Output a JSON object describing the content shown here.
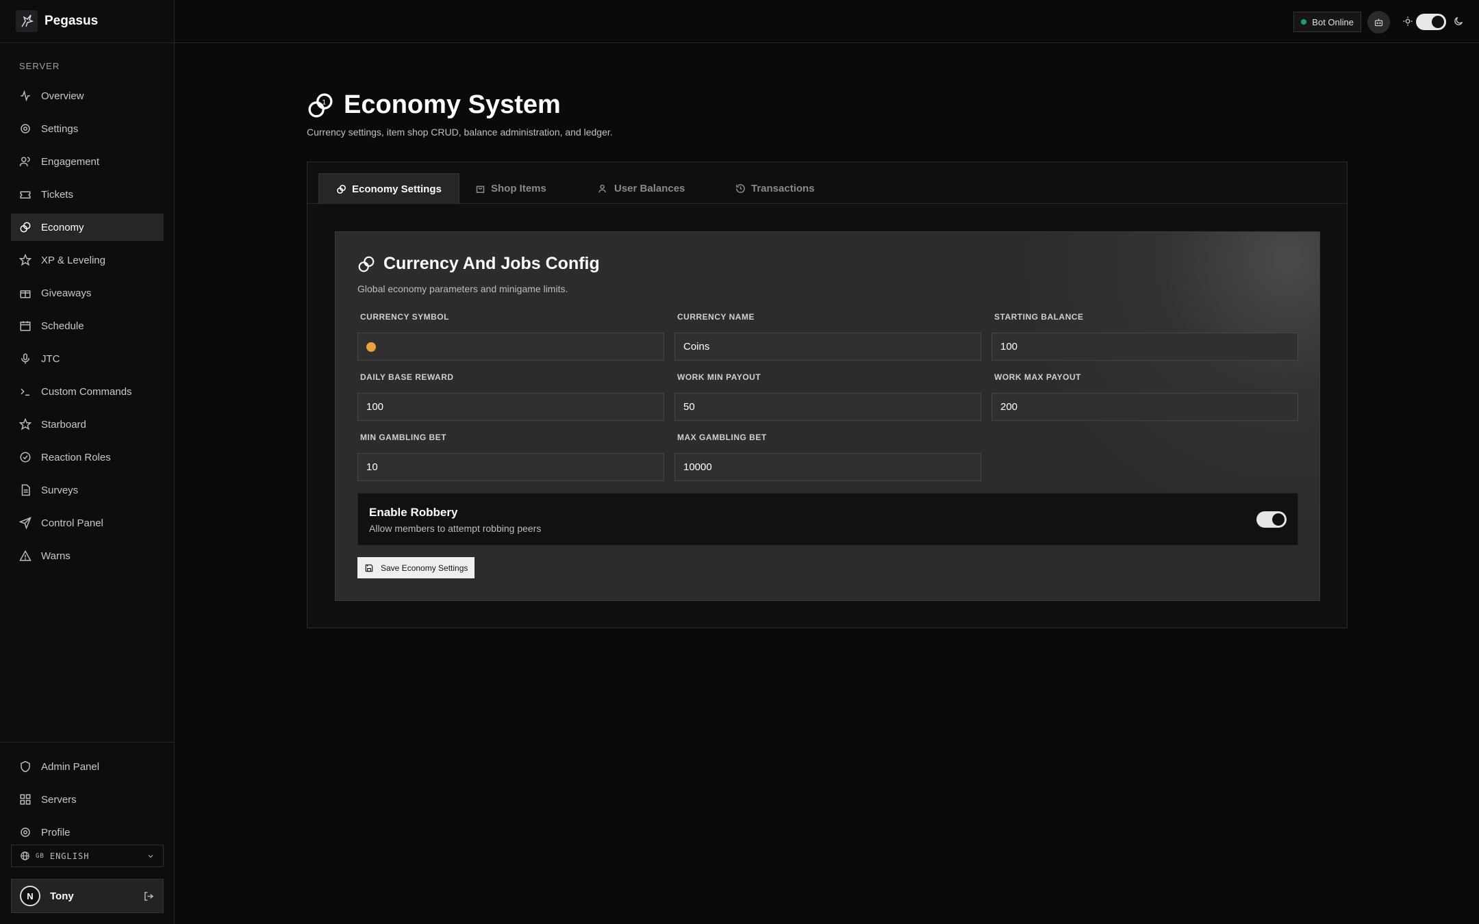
{
  "brand": {
    "name": "Pegasus",
    "logo_icon": "pegasus-logo"
  },
  "sidebar": {
    "section_label": "SERVER",
    "items": [
      {
        "label": "Overview",
        "icon": "activity-icon"
      },
      {
        "label": "Settings",
        "icon": "gear-icon"
      },
      {
        "label": "Engagement",
        "icon": "users-icon"
      },
      {
        "label": "Tickets",
        "icon": "ticket-icon"
      },
      {
        "label": "Economy",
        "icon": "coins-icon",
        "active": true
      },
      {
        "label": "XP & Leveling",
        "icon": "star-icon"
      },
      {
        "label": "Giveaways",
        "icon": "gift-icon"
      },
      {
        "label": "Schedule",
        "icon": "calendar-icon"
      },
      {
        "label": "JTC",
        "icon": "mic-icon"
      },
      {
        "label": "Custom Commands",
        "icon": "terminal-icon"
      },
      {
        "label": "Starboard",
        "icon": "star-icon"
      },
      {
        "label": "Reaction Roles",
        "icon": "check-circle-icon"
      },
      {
        "label": "Surveys",
        "icon": "document-icon"
      },
      {
        "label": "Control Panel",
        "icon": "send-icon"
      },
      {
        "label": "Warns",
        "icon": "warning-icon"
      }
    ],
    "bottom_items": [
      {
        "label": "Admin Panel",
        "icon": "shield-icon"
      },
      {
        "label": "Servers",
        "icon": "grid-icon"
      },
      {
        "label": "Profile",
        "icon": "gear-icon"
      }
    ],
    "language": {
      "flag": "GB",
      "label": "ENGLISH"
    },
    "user": {
      "name": "Tony",
      "avatar_letter": "N"
    }
  },
  "topbar": {
    "bot_status": "Bot Online",
    "status_color": "#22a05a",
    "theme": "dark"
  },
  "page": {
    "title": "Economy System",
    "subtitle": "Currency settings, item shop CRUD, balance administration, and ledger."
  },
  "tabs": [
    {
      "label": "Economy Settings",
      "icon": "coins-icon",
      "active": true
    },
    {
      "label": "Shop Items",
      "icon": "bag-icon"
    },
    {
      "label": "User Balances",
      "icon": "users-icon"
    },
    {
      "label": "Transactions",
      "icon": "history-icon"
    }
  ],
  "card": {
    "title": "Currency And Jobs Config",
    "subtitle": "Global economy parameters and minigame limits.",
    "fields": {
      "currency_symbol": {
        "label": "CURRENCY SYMBOL",
        "value": "🟠"
      },
      "currency_name": {
        "label": "CURRENCY NAME",
        "value": "Coins"
      },
      "starting_balance": {
        "label": "STARTING BALANCE",
        "value": "100"
      },
      "daily_base_reward": {
        "label": "DAILY BASE REWARD",
        "value": "100"
      },
      "work_min_payout": {
        "label": "WORK MIN PAYOUT",
        "value": "50"
      },
      "work_max_payout": {
        "label": "WORK MAX PAYOUT",
        "value": "200"
      },
      "min_gambling_bet": {
        "label": "MIN GAMBLING BET",
        "value": "10"
      },
      "max_gambling_bet": {
        "label": "MAX GAMBLING BET",
        "value": "10000"
      }
    },
    "robbery": {
      "title": "Enable Robbery",
      "description": "Allow members to attempt robbing peers",
      "enabled": true
    },
    "save_label": "Save Economy Settings"
  }
}
